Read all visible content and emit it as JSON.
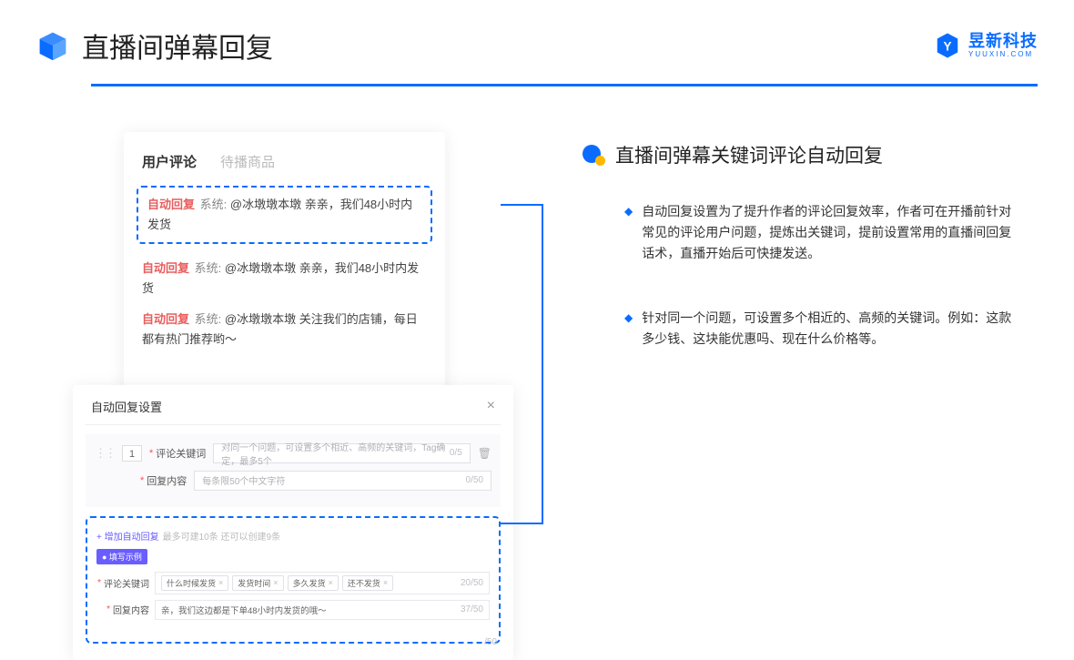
{
  "header": {
    "title": "直播间弹幕回复",
    "brand_name": "昱新科技",
    "brand_sub": "YUUXIN.COM"
  },
  "comments": {
    "tab_active": "用户评论",
    "tab_inactive": "待播商品",
    "items": [
      {
        "tag": "自动回复",
        "sys": "系统:",
        "text": "@冰墩墩本墩 亲亲，我们48小时内发货"
      },
      {
        "tag": "自动回复",
        "sys": "系统:",
        "text": "@冰墩墩本墩 亲亲，我们48小时内发货"
      },
      {
        "tag": "自动回复",
        "sys": "系统:",
        "text": "@冰墩墩本墩 关注我们的店铺，每日都有热门推荐哟～"
      }
    ]
  },
  "settings": {
    "title": "自动回复设置",
    "index": "1",
    "keyword_label": "评论关键词",
    "keyword_placeholder": "对同一个问题，可设置多个相近、高频的关键词，Tag确定，最多5个",
    "keyword_count": "0/5",
    "content_label": "回复内容",
    "content_placeholder": "每条限50个中文字符",
    "content_count": "0/50",
    "add_link": "+ 增加自动回复",
    "add_hint": "最多可建10条 还可以创建9条",
    "pill": "● 填写示例",
    "example_keyword_label": "评论关键词",
    "example_tags": [
      "什么时候发货",
      "发货时间",
      "多久发货",
      "还不发货"
    ],
    "example_keyword_count": "20/50",
    "example_content_label": "回复内容",
    "example_content_value": "亲，我们这边都是下单48小时内发货的哦～",
    "example_content_count": "37/50",
    "outer_count": "/50"
  },
  "right": {
    "section_title": "直播间弹幕关键词评论自动回复",
    "bullets": [
      "自动回复设置为了提升作者的评论回复效率，作者可在开播前针对常见的评论用户问题，提炼出关键词，提前设置常用的直播间回复话术，直播开始后可快捷发送。",
      "针对同一个问题，可设置多个相近的、高频的关键词。例如：这款多少钱、这块能优惠吗、现在什么价格等。"
    ]
  }
}
